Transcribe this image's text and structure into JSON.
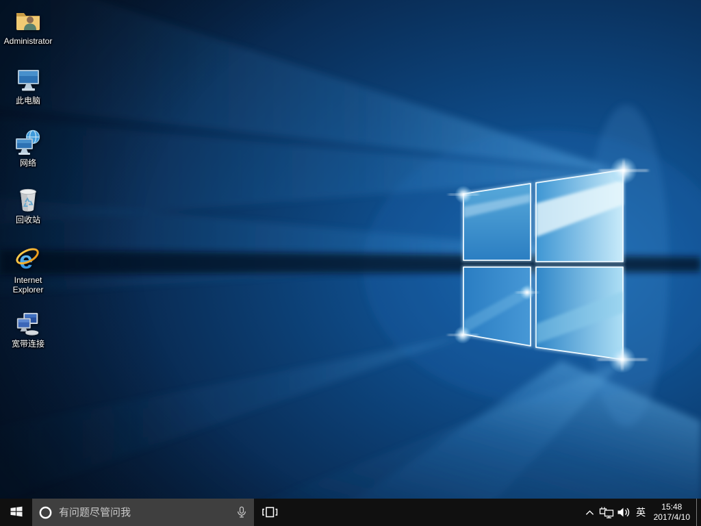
{
  "desktop": {
    "icons": [
      {
        "label": "Administrator",
        "icon": "user-folder-icon"
      },
      {
        "label": "此电脑",
        "icon": "this-pc-icon"
      },
      {
        "label": "网络",
        "icon": "network-icon"
      },
      {
        "label": "回收站",
        "icon": "recycle-bin-icon"
      },
      {
        "label": "Internet Explorer",
        "icon": "internet-explorer-icon"
      },
      {
        "label": "宽带连接",
        "icon": "broadband-connection-icon"
      }
    ]
  },
  "taskbar": {
    "search": {
      "placeholder": "有问题尽管问我"
    },
    "tray": {
      "ime": "英"
    },
    "clock": {
      "time": "15:48",
      "date": "2017/4/10"
    }
  },
  "colors": {
    "taskbar_bg": "#101010",
    "search_bg": "#3f3f3f",
    "wallpaper_base": "#0a2c55",
    "wallpaper_accent": "#2e86cc",
    "logo_edge": "#f0faff"
  }
}
